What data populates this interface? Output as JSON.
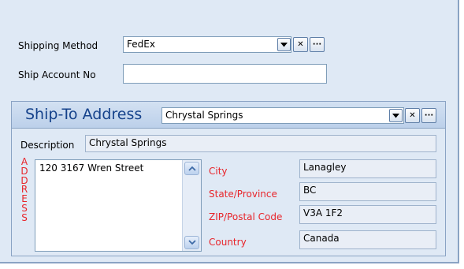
{
  "shipping": {
    "method_label": "Shipping Method",
    "method_value": "FedEx",
    "account_label": "Ship Account No",
    "account_value": ""
  },
  "ship_to": {
    "title": "Ship-To Address",
    "selected": "Chrystal Springs",
    "description_label": "Description",
    "description_value": "Chrystal Springs",
    "address_label_letters": [
      "A",
      "D",
      "D",
      "R",
      "E",
      "S",
      "S"
    ],
    "address_value": "120 3167 Wren Street",
    "fields": [
      {
        "label": "City",
        "value": "Lanagley"
      },
      {
        "label": "State/Province",
        "value": "BC"
      },
      {
        "label": "ZIP/Postal Code",
        "value": "V3A 1F2"
      },
      {
        "label": "Country",
        "value": "Canada"
      }
    ]
  },
  "buttons": {
    "clear_glyph": "✕",
    "more_glyph": "···"
  },
  "icons": {
    "dropdown": "chevron-down-icon",
    "clear": "close-icon",
    "more": "ellipsis-icon",
    "scroll_up": "chevron-up-icon",
    "scroll_down": "chevron-down-icon"
  },
  "colors": {
    "panel_bg": "#dfe9f5",
    "title": "#15428b",
    "required_label": "#e8252b",
    "border": "#7f9db9"
  }
}
